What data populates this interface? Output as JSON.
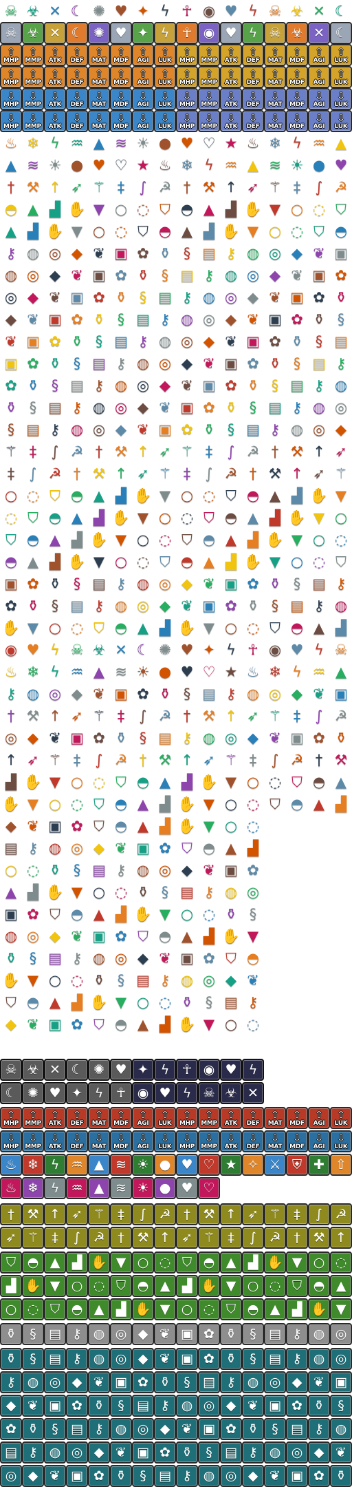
{
  "stats": [
    "MHP",
    "MMP",
    "ATK",
    "DEF",
    "MAT",
    "MDF",
    "AGI",
    "LUK"
  ],
  "colors": {
    "background": "#ffffff",
    "buff_red": "#b83a26",
    "debuff_blue": "#2a6fa0",
    "olive": "#8f8a1e",
    "green": "#3f8a2a",
    "gray": "#8e8e8e",
    "teal": "#1f6f78",
    "brown": "#7a5a1e",
    "purple": "#8a3a7a",
    "state_gray": "#5a5a5a",
    "state_dark": "#2a2a4a"
  },
  "icon_groups": {
    "status_effects": [
      "skull-icon",
      "poison-icon",
      "silence-icon",
      "sleep-icon",
      "confusion-icon",
      "charm-icon",
      "stun-icon",
      "paralysis-icon",
      "curse-icon",
      "blind-icon",
      "heart-icon",
      "lightning-icon"
    ],
    "elements": [
      "fire-icon",
      "ice-icon",
      "thunder-icon",
      "water-icon",
      "earth-icon",
      "wind-icon",
      "light-icon",
      "dark-icon",
      "heart-icon",
      "broken-heart-icon",
      "star-icon"
    ],
    "weapons": [
      "sword-icon",
      "axe-icon",
      "spear-icon",
      "bow-icon",
      "staff-icon",
      "dagger-icon",
      "whip-icon",
      "scythe-icon"
    ],
    "armor": [
      "shield-icon",
      "helmet-icon",
      "hat-icon",
      "boots-icon",
      "glove-icon",
      "cloak-icon",
      "ring-icon",
      "necklace-icon"
    ],
    "items": [
      "potion-icon",
      "scroll-icon",
      "book-icon",
      "key-icon",
      "bag-icon",
      "coin-icon",
      "gem-icon",
      "food-icon",
      "chest-icon",
      "flower-icon"
    ],
    "skills": [
      "magic-icon",
      "attack-icon",
      "defend-icon",
      "heal-icon",
      "buff-icon",
      "debuff-icon"
    ]
  }
}
